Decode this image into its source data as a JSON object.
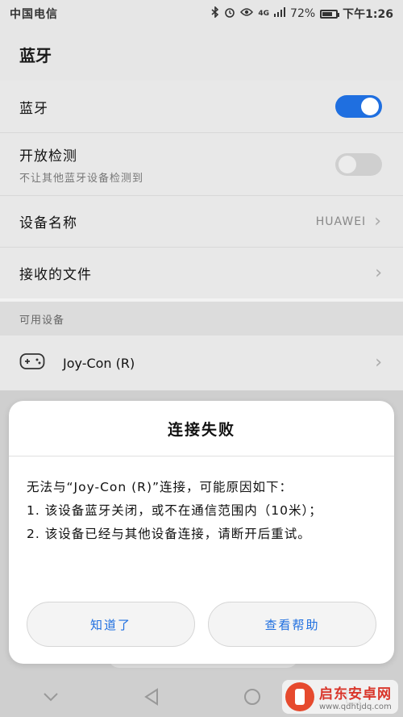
{
  "status": {
    "carrier": "中国电信",
    "network": "4G",
    "battery_percent": "72%",
    "battery_level": 0.72,
    "time": "下午1:26"
  },
  "header": {
    "title": "蓝牙"
  },
  "settings": {
    "bluetooth": {
      "label": "蓝牙",
      "enabled": true
    },
    "discoverable": {
      "label": "开放检测",
      "sub": "不让其他蓝牙设备检测到",
      "enabled": false
    },
    "device_name": {
      "label": "设备名称",
      "value": "HUAWEI"
    },
    "received_files": {
      "label": "接收的文件"
    }
  },
  "available": {
    "header": "可用设备",
    "devices": [
      {
        "name": "Joy-Con (R)",
        "icon": "gamepad-icon"
      }
    ]
  },
  "dialog": {
    "title": "连接失败",
    "line1": "无法与“Joy-Con (R)”连接，可能原因如下：",
    "line2": "1. 该设备蓝牙关闭，或不在通信范围内（10米）；",
    "line3": "2. 该设备已经与其他设备连接，请断开后重试。",
    "ok_label": "知道了",
    "help_label": "查看帮助"
  },
  "watermark": {
    "title": "启东安卓网",
    "url": "www.qdhtjdq.com"
  },
  "colors": {
    "accent": "#1f6fe0",
    "background": "#e8e8e8",
    "dialog": "#ffffff"
  }
}
